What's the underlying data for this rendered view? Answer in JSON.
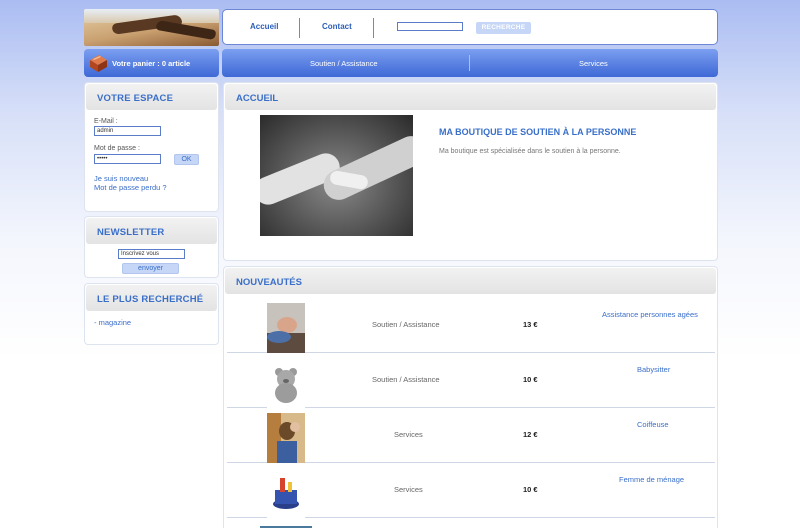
{
  "header": {
    "nav": [
      "Accueil",
      "Contact"
    ],
    "search_button": "RECHERCHE",
    "cart": "Votre panier : 0 article",
    "categories": [
      "Soutien / Assistance",
      "Services"
    ]
  },
  "sidebar": {
    "account": {
      "title": "VOTRE ESPACE",
      "email_label": "E-Mail :",
      "email_value": "admin",
      "password_label": "Mot de passe :",
      "password_value": "•••••",
      "ok_button": "OK",
      "new_user_link": "Je suis nouveau",
      "forgot_link": "Mot de passe perdu ?"
    },
    "newsletter": {
      "title": "NEWSLETTER",
      "input_value": "Inscrivez vous",
      "button": "envoyer"
    },
    "popular": {
      "title": "LE PLUS RECHERCHÉ",
      "items": [
        "- magazine"
      ]
    }
  },
  "main": {
    "home": {
      "title": "ACCUEIL",
      "heading": "MA BOUTIQUE DE SOUTIEN À LA PERSONNE",
      "text": "Ma boutique est spécialisée dans le soutien à la personne."
    },
    "news": {
      "title": "NOUVEAUTÉS",
      "products": [
        {
          "category": "Soutien / Assistance",
          "price": "13 €",
          "name": "Assistance personnes agées",
          "thumb": "elderly-care-photo"
        },
        {
          "category": "Soutien / Assistance",
          "price": "10 €",
          "name": "Babysitter",
          "thumb": "teddy-bear-photo"
        },
        {
          "category": "Services",
          "price": "12 €",
          "name": "Coiffeuse",
          "thumb": "hairdresser-photo"
        },
        {
          "category": "Services",
          "price": "10 €",
          "name": "Femme de ménage",
          "thumb": "cleaning-supplies-photo"
        }
      ]
    }
  },
  "colors": {
    "accent": "#3a6fc9",
    "bar_top": "#7b9ff0",
    "bar_bottom": "#3e68d6"
  }
}
